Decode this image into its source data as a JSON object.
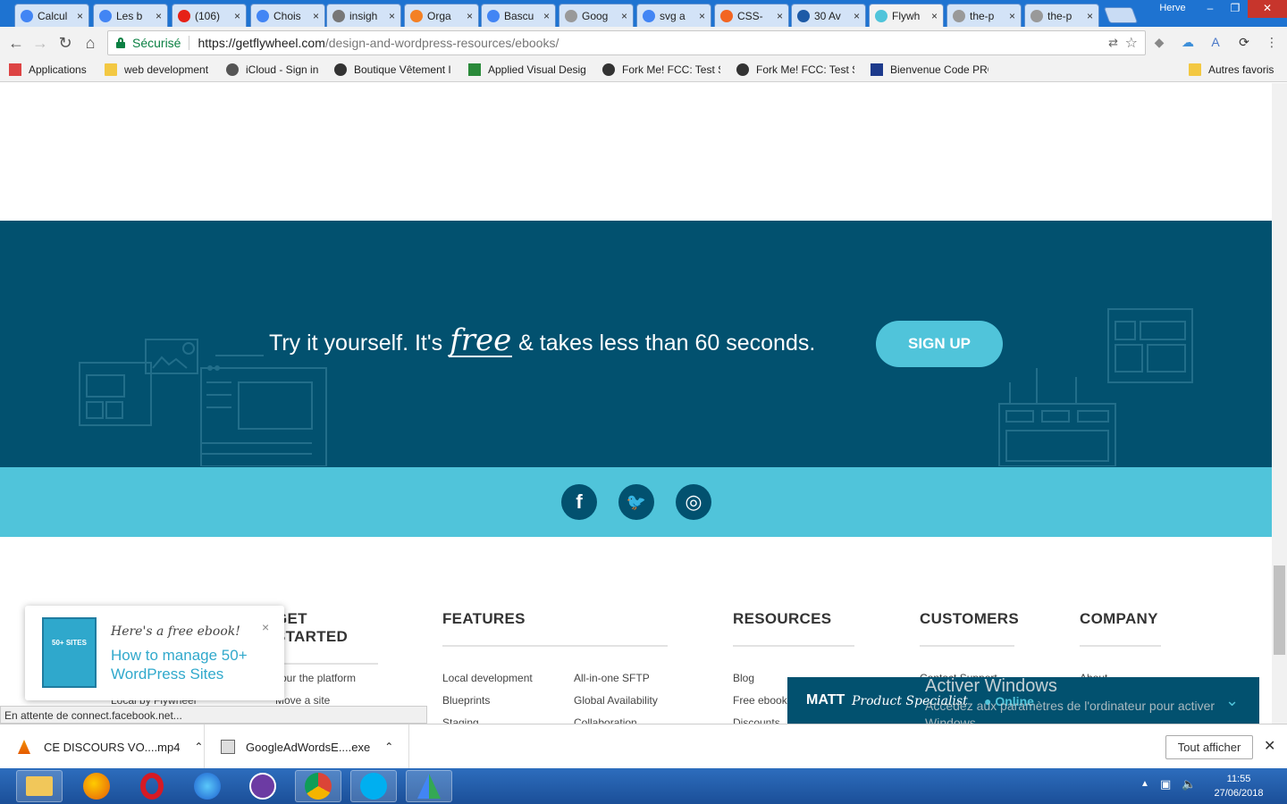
{
  "browser": {
    "user": "Herve",
    "tabs": [
      {
        "title": "Calcul",
        "icon": "google-icon",
        "color": "#4285f4"
      },
      {
        "title": "Les b",
        "icon": "google-icon",
        "color": "#4285f4"
      },
      {
        "title": "(106)",
        "icon": "youtube-icon",
        "color": "#e62117"
      },
      {
        "title": "Chois",
        "icon": "google-icon",
        "color": "#4285f4"
      },
      {
        "title": "insigh",
        "icon": "gear-icon",
        "color": "#777777"
      },
      {
        "title": "Orga",
        "icon": "orange-swirl-icon",
        "color": "#f48024"
      },
      {
        "title": "Bascu",
        "icon": "google-icon",
        "color": "#4285f4"
      },
      {
        "title": "Goog",
        "icon": "document-icon",
        "color": "#999999"
      },
      {
        "title": "svg a",
        "icon": "google-icon",
        "color": "#4285f4"
      },
      {
        "title": "CSS-",
        "icon": "asterisk-icon",
        "color": "#f26522"
      },
      {
        "title": "30 Av",
        "icon": "h-icon",
        "color": "#1d5aa6"
      },
      {
        "title": "Flywh",
        "icon": "flywheel-icon",
        "color": "#50c4da",
        "active": true
      },
      {
        "title": "the-p",
        "icon": "document-icon",
        "color": "#999999"
      },
      {
        "title": "the-p",
        "icon": "document-icon",
        "color": "#999999"
      }
    ],
    "secure_label": "Sécurisé",
    "url_host": "https://getflywheel.com",
    "url_path": "/design-and-wordpress-resources/ebooks/",
    "bookmarks": [
      {
        "label": "Applications",
        "icon": "apps-grid-icon"
      },
      {
        "label": "web development",
        "icon": "folder-icon"
      },
      {
        "label": "iCloud - Sign in",
        "icon": "apple-icon"
      },
      {
        "label": "Boutique Vêtement I",
        "icon": "camera-icon"
      },
      {
        "label": "Applied Visual Desig",
        "icon": "green-book-icon"
      },
      {
        "label": "Fork Me! FCC: Test S",
        "icon": "codepen-icon"
      },
      {
        "label": "Fork Me! FCC: Test S",
        "icon": "codepen-icon"
      },
      {
        "label": "Bienvenue Code PRO",
        "icon": "code-pro-icon"
      },
      {
        "label": "Autres favoris",
        "icon": "folder-icon"
      }
    ]
  },
  "cta": {
    "text_before": "Try it yourself. It's ",
    "text_free": "free",
    "text_after": " & takes less than 60 seconds.",
    "button": "SIGN UP"
  },
  "social": [
    {
      "icon": "facebook-icon",
      "glyph": "f"
    },
    {
      "icon": "twitter-icon",
      "glyph": "🐦"
    },
    {
      "icon": "instagram-icon",
      "glyph": "◎"
    }
  ],
  "footer": {
    "columns": [
      {
        "heading": "GET STARTED",
        "links": [
          "Tour the platform",
          "Local by Flywheel",
          "Move a site"
        ]
      },
      {
        "heading": "FEATURES",
        "links": [
          "Local development",
          "Blueprints",
          "Staging",
          "All-in-one SFTP",
          "Global Availability",
          "Collaboration"
        ]
      },
      {
        "heading": "RESOURCES",
        "links": [
          "Blog",
          "Free ebooks",
          "Discounts"
        ]
      },
      {
        "heading": "CUSTOMERS",
        "links": [
          "Contact Support"
        ]
      },
      {
        "heading": "COMPANY",
        "links": [
          "About"
        ]
      }
    ]
  },
  "popup": {
    "label": "Here's a free ebook!",
    "title": "How to manage 50+ WordPress Sites",
    "book_cover": "50+ SITES",
    "close": "×"
  },
  "chat": {
    "name": "MATT",
    "role": "Product Specialist",
    "status": "● Online"
  },
  "windows_watermark": {
    "title": "Activer Windows",
    "subtitle": "Accédez aux paramètres de l'ordinateur pour activer Windows."
  },
  "status_text": "En attente de connect.facebook.net...",
  "downloads": {
    "items": [
      {
        "name": "CE DISCOURS VO....mp4",
        "icon": "vlc-icon"
      },
      {
        "name": "GoogleAdWordsE....exe",
        "icon": "installer-icon"
      }
    ],
    "show_all": "Tout afficher"
  },
  "taskbar": {
    "apps": [
      "file-explorer-icon",
      "firefox-icon",
      "opera-icon",
      "firefox-developer-icon",
      "app-cat-icon",
      "chrome-icon",
      "skype-icon",
      "adwords-icon"
    ],
    "time": "11:55",
    "date": "27/06/2018"
  }
}
